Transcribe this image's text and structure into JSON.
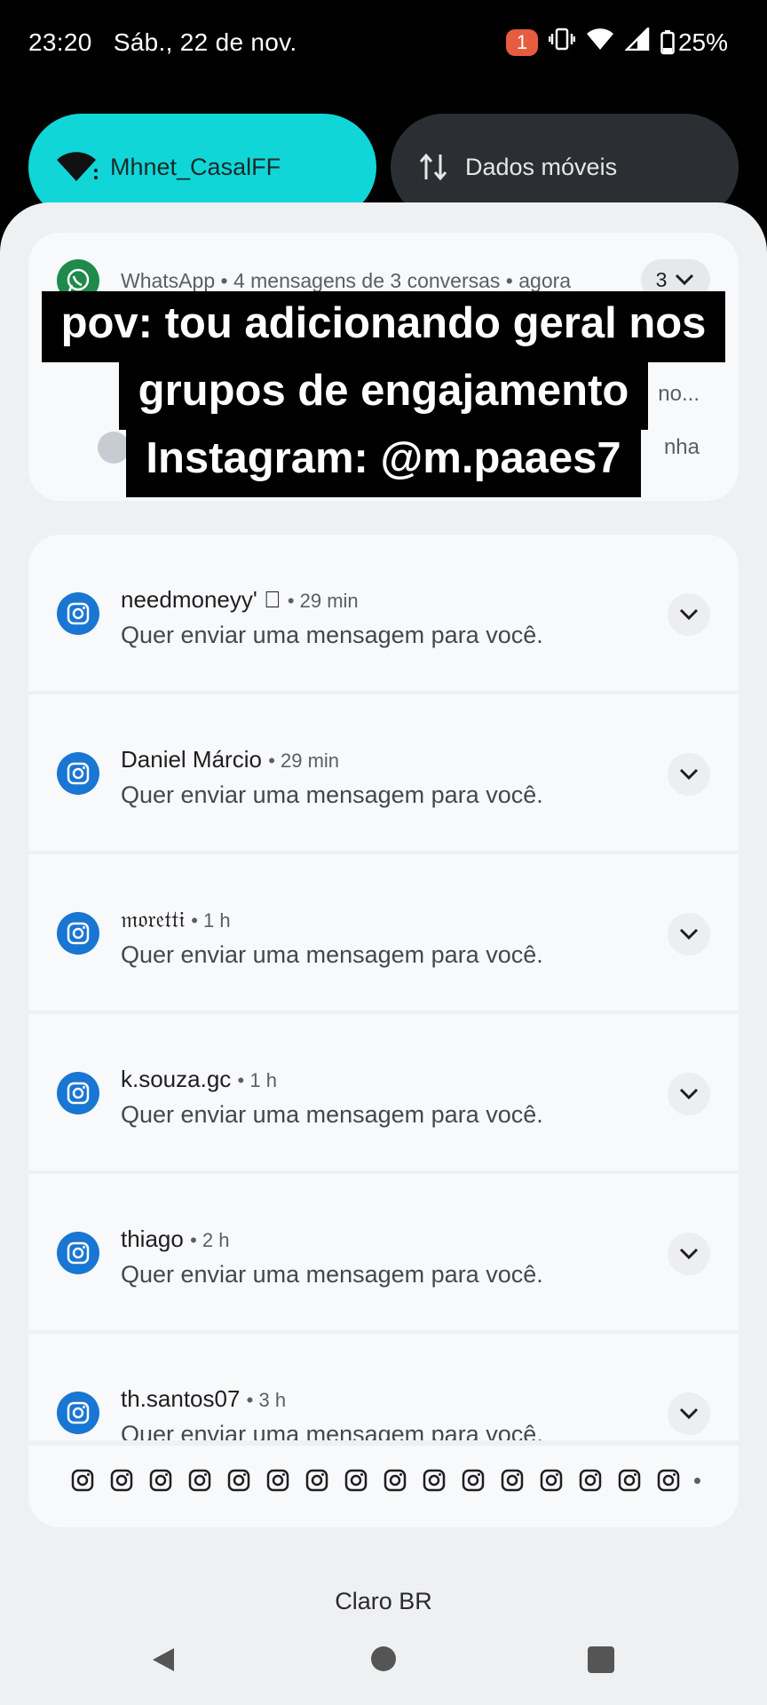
{
  "status": {
    "time": "23:20",
    "date": "Sáb., 22 de nov.",
    "badge": "1",
    "battery": "25%"
  },
  "tiles": {
    "wifi": "Mhnet_CasalFF",
    "data": "Dados móveis"
  },
  "whatsapp": {
    "header": "WhatsApp • 4 mensagens de 3 conversas • agora",
    "count": "3",
    "peek1": "no...",
    "peek2": "nha"
  },
  "overlay": {
    "line1": "pov: tou adicionando geral nos",
    "line2": "grupos de engajamento",
    "line3": "Instagram: @m.paaes7"
  },
  "instagram": [
    {
      "name": "needmoneyy' ⃞",
      "time": "• 29 min",
      "text": "Quer enviar uma mensagem para você."
    },
    {
      "name": "Daniel Márcio",
      "time": "• 29 min",
      "text": "Quer enviar uma mensagem para você."
    },
    {
      "name": "𝔪𝔬𝔯𝔢𝔱𝔱𝔦",
      "time": "• 1 h",
      "text": "Quer enviar uma mensagem para você."
    },
    {
      "name": "k.souza.gc",
      "time": "• 1 h",
      "text": "Quer enviar uma mensagem para você."
    },
    {
      "name": "thiago",
      "time": "• 2 h",
      "text": "Quer enviar uma mensagem para você."
    },
    {
      "name": "th.santos07",
      "time": "• 3 h",
      "text": "Quer enviar uma mensagem para você."
    }
  ],
  "summary_icon_count": 16,
  "carrier": "Claro BR",
  "colors": {
    "wifi_tile": "#11d6d8",
    "instagram_icon": "#1976d2",
    "whatsapp_icon": "#1f8a4c",
    "badge": "#e65c3f"
  }
}
